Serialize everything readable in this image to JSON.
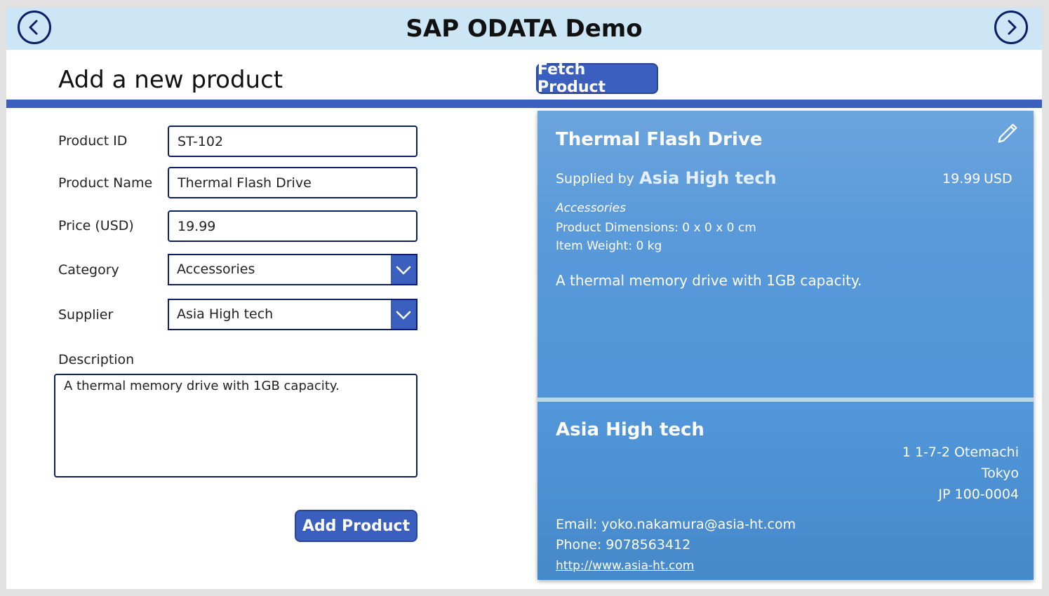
{
  "header": {
    "title": "SAP ODATA Demo",
    "back_icon": "chevron-left-icon",
    "next_icon": "chevron-right-icon"
  },
  "page": {
    "title": "Add a new product",
    "fetch_button": "Fetch Product"
  },
  "form": {
    "product_id": {
      "label": "Product ID",
      "value": "ST-102"
    },
    "product_name": {
      "label": "Product Name",
      "value": "Thermal Flash Drive"
    },
    "price": {
      "label": "Price (USD)",
      "value": "19.99"
    },
    "category": {
      "label": "Category",
      "value": "Accessories"
    },
    "supplier": {
      "label": "Supplier",
      "value": "Asia High tech"
    },
    "description": {
      "label": "Description",
      "value": "A thermal memory drive with 1GB capacity."
    },
    "add_button": "Add Product"
  },
  "product_card": {
    "name": "Thermal Flash Drive",
    "supplied_by_label": "Supplied by",
    "supplier": "Asia High tech",
    "price": "19.99",
    "currency": "USD",
    "category": "Accessories",
    "dimensions": "Product Dimensions: 0 x 0 x 0 cm",
    "weight": "Item Weight: 0 kg",
    "description": "A thermal memory drive with 1GB capacity.",
    "edit_icon": "pencil-icon"
  },
  "supplier_card": {
    "name": "Asia High tech",
    "address_line1": "1 1-7-2 Otemachi",
    "city": "Tokyo",
    "postal": "JP 100-0004",
    "email": "Email: yoko.nakamura@asia-ht.com",
    "phone": "Phone: 9078563412",
    "website": "http://www.asia-ht.com"
  },
  "colors": {
    "header_bg": "#cce6f6",
    "accent": "#3a5fbe",
    "border": "#0b1f66",
    "card": "#5a9ada"
  }
}
